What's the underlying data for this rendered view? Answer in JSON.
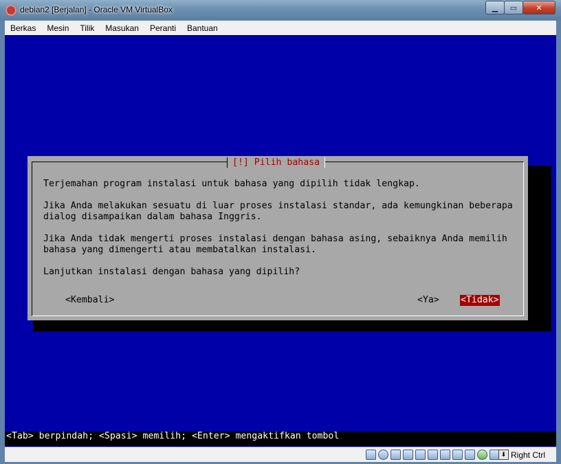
{
  "window": {
    "title": "debian2 [Berjalan] - Oracle VM VirtualBox",
    "minimize_glyph": "▁",
    "maximize_glyph": "▭",
    "close_glyph": "✕"
  },
  "menu": [
    "Berkas",
    "Mesin",
    "Tilik",
    "Masukan",
    "Peranti",
    "Bantuan"
  ],
  "dialog": {
    "title": "[!] Pilih bahasa",
    "paragraphs": [
      "Terjemahan program instalasi untuk bahasa yang dipilih tidak lengkap.",
      "Jika Anda melakukan sesuatu di luar proses instalasi standar, ada kemungkinan beberapa\ndialog disampaikan dalam bahasa Inggris.",
      "Jika Anda tidak mengerti proses instalasi dengan bahasa asing, sebaiknya Anda memilih\nbahasa yang dimengerti atau membatalkan instalasi.",
      "Lanjutkan instalasi dengan bahasa yang dipilih?"
    ],
    "buttons": {
      "back": "<Kembali>",
      "yes": "<Ya>",
      "no": "<Tidak>"
    },
    "selected_button": "no"
  },
  "help_line": "<Tab> berpindah; <Spasi> memilih; <Enter> mengaktifkan tombol",
  "statusbar": {
    "icons": [
      "hard-disk-icon",
      "optical-disk-icon",
      "floppy-icon",
      "network-icon",
      "usb-icon",
      "shared-folder-icon",
      "display-icon",
      "video-capture-icon",
      "virtualization-icon",
      "mouse-integration-icon",
      "keyboard-icon"
    ],
    "host_key": "Right Ctrl"
  },
  "colors": {
    "console_bg": "#0000a8",
    "dialog_bg": "#a8a8a8",
    "title_red": "#a80000",
    "selected_bg": "#a80000"
  }
}
